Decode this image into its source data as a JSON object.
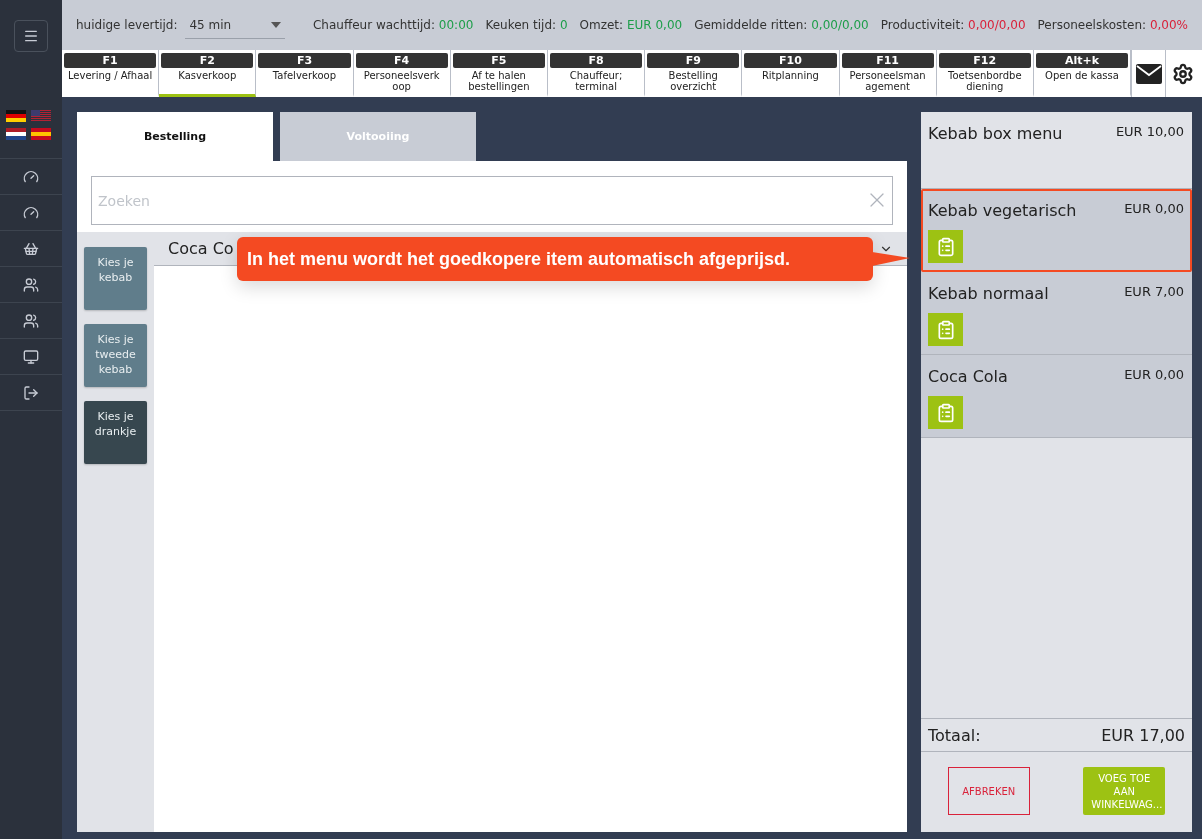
{
  "delivery_time": {
    "label": "huidige levertijd:",
    "value": "45 min"
  },
  "stats": [
    {
      "label": "Chauffeur wachttijd:",
      "value": "00:00",
      "color": "#1e9e4a"
    },
    {
      "label": "Keuken tijd:",
      "value": "0",
      "color": "#1e9e4a"
    },
    {
      "label": "Omzet:",
      "value": "EUR 0,00",
      "color": "#1e9e4a"
    },
    {
      "label": "Gemiddelde ritten:",
      "value": "0,00/0,00",
      "color": "#1e9e4a"
    },
    {
      "label": "Productiviteit:",
      "value": "0,00/0,00",
      "color": "#d9223a"
    },
    {
      "label": "Personeelskosten:",
      "value": "0,00%",
      "color": "#d9223a"
    }
  ],
  "function_tabs": [
    {
      "key": "F1",
      "label": "Levering / Afhaal",
      "selected": false
    },
    {
      "key": "F2",
      "label": "Kasverkoop",
      "selected": true
    },
    {
      "key": "F3",
      "label": "Tafelverkoop",
      "selected": false
    },
    {
      "key": "F4",
      "label": "Personeelsverk oop",
      "selected": false
    },
    {
      "key": "F5",
      "label": "Af te halen bestellingen",
      "selected": false
    },
    {
      "key": "F8",
      "label": "Chauffeur; terminal",
      "selected": false
    },
    {
      "key": "F9",
      "label": "Bestelling overzicht",
      "selected": false
    },
    {
      "key": "F10",
      "label": "Ritplanning",
      "selected": false
    },
    {
      "key": "F11",
      "label": "Personeelsman agement",
      "selected": false
    },
    {
      "key": "F12",
      "label": "Toetsenbordbe diening",
      "selected": false
    },
    {
      "key": "Alt+k",
      "label": "Open de kassa",
      "selected": false
    }
  ],
  "order_tabs": [
    {
      "label": "Bestelling",
      "selected": true
    },
    {
      "label": "Voltooiing",
      "selected": false
    }
  ],
  "search": {
    "placeholder": "Zoeken"
  },
  "categories": [
    {
      "label": "Kies je kebab",
      "selected": false
    },
    {
      "label": "Kies je tweede kebab",
      "selected": false
    },
    {
      "label": "Kies je drankje",
      "selected": true
    }
  ],
  "dropdown": {
    "value": "Coca Co"
  },
  "callout": {
    "text": "In het menu wordt het goedkopere item automatisch afgeprijsd."
  },
  "cart": {
    "items": [
      {
        "kind": "menu",
        "name": "Kebab box menu",
        "price": "EUR 10,00",
        "highlighted": false
      },
      {
        "kind": "component",
        "name": "Kebab vegetarisch",
        "price": "EUR 0,00",
        "highlighted": true
      },
      {
        "kind": "component",
        "name": "Kebab normaal",
        "price": "EUR 7,00",
        "highlighted": false
      },
      {
        "kind": "component",
        "name": "Coca Cola",
        "price": "EUR 0,00",
        "highlighted": false
      }
    ],
    "total_label": "Totaal:",
    "total": "EUR 17,00",
    "cancel": "AFBREKEN",
    "add": "VOEG TOE AAN WINKELWAG..."
  }
}
